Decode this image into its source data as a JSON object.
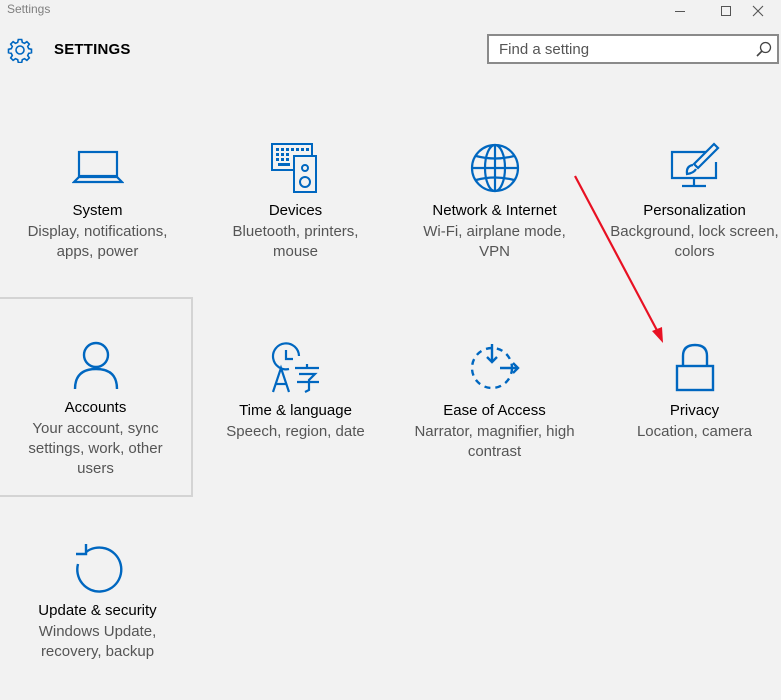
{
  "window": {
    "title": "Settings",
    "controls": {
      "minimize_icon": "minimize-icon",
      "maximize_icon": "maximize-icon",
      "close_icon": "close-icon"
    }
  },
  "header": {
    "app_title": "SETTINGS",
    "search": {
      "placeholder": "Find a setting",
      "value": ""
    }
  },
  "colors": {
    "accent": "#0067c0",
    "annotation_arrow": "#e81123",
    "tile_border": "#d4d4d4"
  },
  "tiles": [
    {
      "name": "System",
      "description": "Display, notifications, apps, power",
      "icon": "laptop-icon"
    },
    {
      "name": "Devices",
      "description": "Bluetooth, printers, mouse",
      "icon": "keyboard-speaker-icon"
    },
    {
      "name": "Network & Internet",
      "description": "Wi-Fi, airplane mode, VPN",
      "icon": "globe-icon"
    },
    {
      "name": "Personalization",
      "description": "Background, lock screen, colors",
      "icon": "paint-monitor-icon"
    },
    {
      "name": "Accounts",
      "description": "Your account, sync settings, work, other users",
      "icon": "person-icon",
      "selected": true
    },
    {
      "name": "Time & language",
      "description": "Speech, region, date",
      "icon": "clock-language-icon"
    },
    {
      "name": "Ease of Access",
      "description": "Narrator, magnifier, high contrast",
      "icon": "ease-of-access-icon"
    },
    {
      "name": "Privacy",
      "description": "Location, camera",
      "icon": "lock-icon"
    },
    {
      "name": "Update & security",
      "description": "Windows Update, recovery, backup",
      "icon": "refresh-icon"
    }
  ]
}
